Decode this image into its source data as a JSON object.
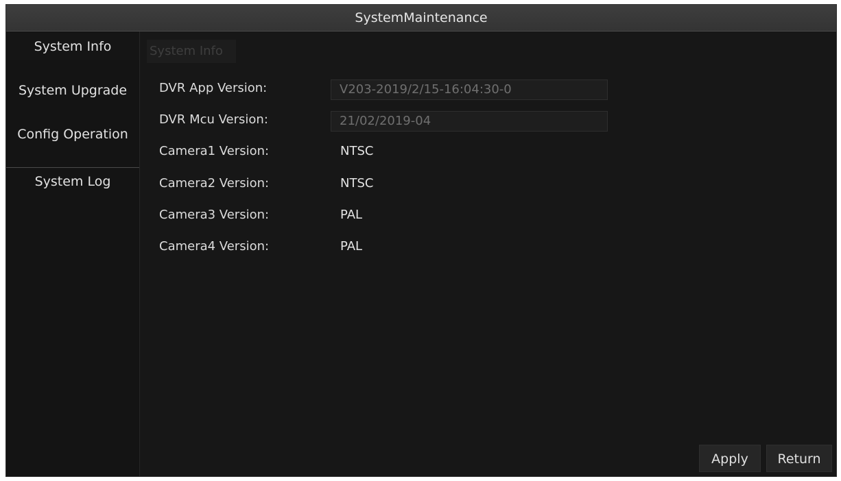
{
  "window": {
    "title": "SystemMaintenance"
  },
  "sidebar": {
    "items": [
      {
        "label": "System Info"
      },
      {
        "label": "System Upgrade"
      },
      {
        "label": "Config Operation"
      },
      {
        "label": "System Log"
      }
    ]
  },
  "panel": {
    "header": "System Info",
    "rows": [
      {
        "label": "DVR App Version:",
        "value": "V203-2019/2/15-16:04:30-0"
      },
      {
        "label": "DVR Mcu Version:",
        "value": "21/02/2019-04"
      },
      {
        "label": "Camera1 Version:",
        "value": "NTSC"
      },
      {
        "label": "Camera2 Version:",
        "value": "NTSC"
      },
      {
        "label": "Camera3 Version:",
        "value": "PAL"
      },
      {
        "label": "Camera4 Version:",
        "value": "PAL"
      }
    ]
  },
  "buttons": {
    "apply": "Apply",
    "return": "Return"
  }
}
